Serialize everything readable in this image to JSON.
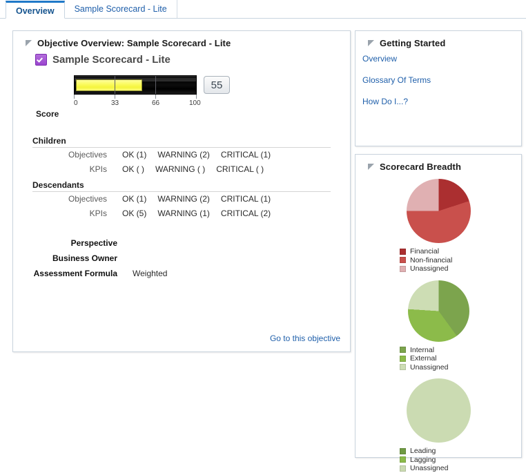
{
  "tabs": [
    {
      "label": "Overview",
      "active": true
    },
    {
      "label": "Sample Scorecard - Lite",
      "active": false
    }
  ],
  "objective_card": {
    "title": "Objective Overview: Sample Scorecard - Lite",
    "subtitle": "Sample Scorecard - Lite",
    "icon_name": "scorecard-icon",
    "gauge": {
      "value": "55",
      "value_number": 55,
      "min": 0,
      "max": 100,
      "ticks": [
        "0",
        "33",
        "66",
        "100"
      ],
      "tick_values": [
        0,
        33,
        66,
        100
      ],
      "fill_color": "#f8f84c",
      "track_color": "#000000",
      "label": "Score"
    },
    "children": {
      "heading": "Children",
      "rows": [
        {
          "label": "Objectives",
          "values": [
            "OK (1)",
            "WARNING (2)",
            "CRITICAL (1)"
          ]
        },
        {
          "label": "KPIs",
          "values": [
            "OK ( )",
            "WARNING ( )",
            "CRITICAL ( )"
          ]
        }
      ]
    },
    "descendants": {
      "heading": "Descendants",
      "rows": [
        {
          "label": "Objectives",
          "values": [
            "OK (1)",
            "WARNING (2)",
            "CRITICAL (1)"
          ]
        },
        {
          "label": "KPIs",
          "values": [
            "OK (5)",
            "WARNING (1)",
            "CRITICAL (2)"
          ]
        }
      ]
    },
    "properties": [
      {
        "label": "Perspective",
        "value": ""
      },
      {
        "label": "Business Owner",
        "value": ""
      },
      {
        "label": "Assessment Formula",
        "value": "Weighted"
      }
    ],
    "footer_link": "Go to this objective"
  },
  "getting_started": {
    "title": "Getting Started",
    "links": [
      "Overview",
      "Glossary Of Terms",
      "How Do I...?"
    ]
  },
  "scorecard_breadth": {
    "title": "Scorecard Breadth"
  },
  "chart_data": [
    {
      "type": "pie",
      "title": "",
      "categories": [
        "Financial",
        "Non-financial",
        "Unassigned"
      ],
      "values": [
        20,
        55,
        25
      ],
      "colors": [
        "#ab2f30",
        "#c9504c",
        "#e0b0b2"
      ],
      "legend_position": "bottom"
    },
    {
      "type": "pie",
      "title": "",
      "categories": [
        "Internal",
        "External",
        "Unassigned"
      ],
      "values": [
        40,
        36,
        24
      ],
      "colors": [
        "#7ca44d",
        "#8cbb4a",
        "#cdddb4"
      ],
      "legend_position": "bottom"
    },
    {
      "type": "pie",
      "title": "",
      "categories": [
        "Leading",
        "Lagging",
        "Unassigned"
      ],
      "values": [
        0,
        0,
        100
      ],
      "colors": [
        "#6f9a42",
        "#8cbb4a",
        "#cbdbb2"
      ],
      "legend_position": "bottom"
    }
  ]
}
